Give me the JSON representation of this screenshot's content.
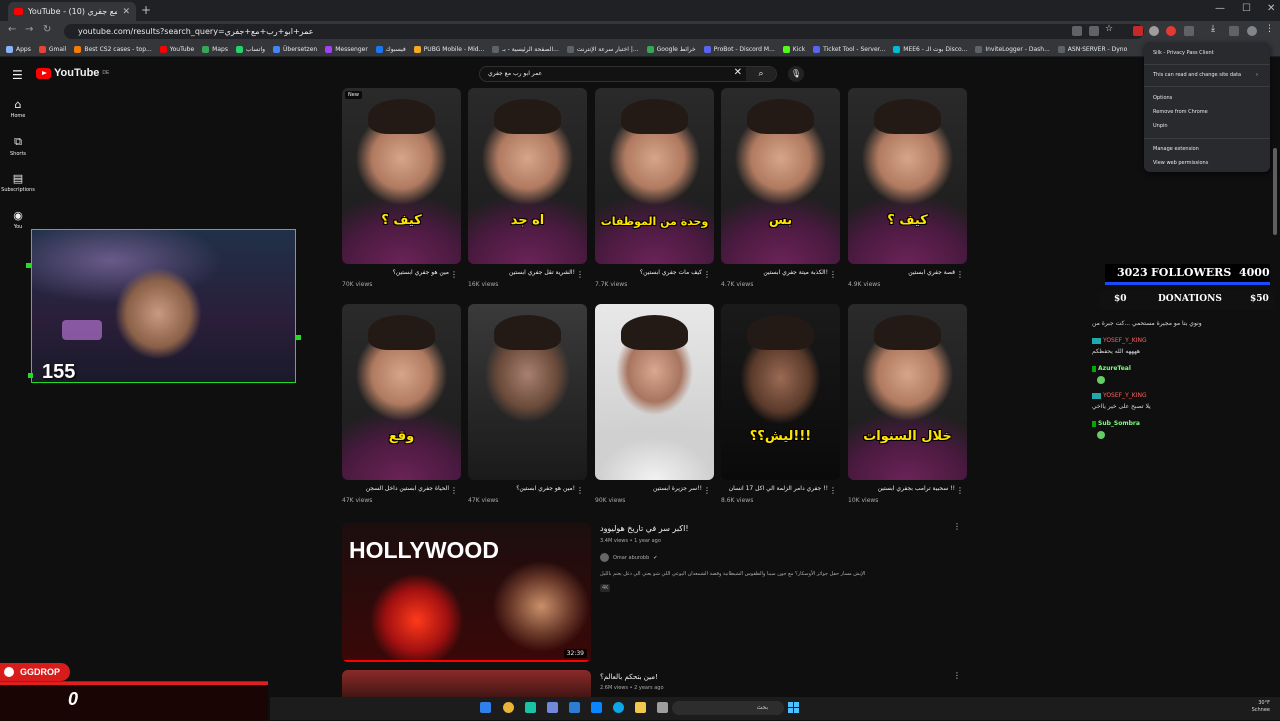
{
  "browser": {
    "tab_title": "YouTube - عمر ابو رب مع جفري (10)",
    "url": "youtube.com/results?search_query=عمر+ابو+رب+مع+جفري",
    "window_controls": [
      "—",
      "☐",
      "✕"
    ],
    "bookmarks": [
      "Apps",
      "Gmail",
      "Best CS2 cases - top...",
      "YouTube",
      "Maps",
      "واتساب",
      "Übersetzen",
      "Messenger",
      "فيسبوك",
      "PUBG Mobile - Mid...",
      "الصفحة الرئيسية - بـ...",
      "اختبار سرعة الإنترنت |...",
      "Google خرائط",
      "ProBot - Discord M...",
      "Kick",
      "Ticket Tool - Server...",
      "MEE6 - بوت الـ Disco...",
      "InviteLogger - Dash...",
      "ASN·SERVER - Dyno"
    ]
  },
  "extension_menu": {
    "header": "Silk - Privacy Pass Client",
    "site_data": "This can read and change site data",
    "options": "Options",
    "remove": "Remove from Chrome",
    "unpin": "Unpin",
    "manage": "Manage extension",
    "permissions": "View web permissions"
  },
  "youtube": {
    "logo": "YouTube",
    "region": "DE",
    "search_query": "عمر ابو رب مع جفري",
    "nav": [
      {
        "label": "Home",
        "icon": "home-icon"
      },
      {
        "label": "Shorts",
        "icon": "shorts-icon"
      },
      {
        "label": "Subscriptions",
        "icon": "subscriptions-icon"
      },
      {
        "label": "You",
        "icon": "you-icon"
      }
    ],
    "shorts_row1": [
      {
        "title": "مين هو جفري ابستين؟",
        "views": "70K views",
        "caption": "كيف ؟",
        "badge": "New"
      },
      {
        "title": "الشرية تقل جفري ابستين!",
        "views": "16K views",
        "caption": "اه جد",
        "badge": ""
      },
      {
        "title": "كيف مات جفري ابستين؟",
        "views": "7.7K views",
        "caption": "وحدة من الموظفات",
        "badge": ""
      },
      {
        "title": "الكذبة ميتة جفري ابستين!",
        "views": "4.7K views",
        "caption": "بس",
        "badge": ""
      },
      {
        "title": "قصة جفري ابستين",
        "views": "4.9K views",
        "caption": "كيف ؟",
        "badge": ""
      }
    ],
    "shorts_row2": [
      {
        "title": "الحياة جفري ابستين داخل السجن",
        "views": "47K views",
        "caption": "وقع"
      },
      {
        "title": "مين هو جفري ابستين؟!",
        "views": "47K views",
        "caption": ""
      },
      {
        "title": "سر جزيرة ابستين!!",
        "views": "90K views",
        "caption": ""
      },
      {
        "title": "جفري دامر الزلمة الي اكل 17 انسان !!",
        "views": "8.6K views",
        "caption": "ليش؟؟!!!"
      },
      {
        "title": "سحبية ترامب بجفري ابستين !!",
        "views": "10K views",
        "caption": "خلال السنوات"
      }
    ],
    "video1": {
      "title": "اكبر سر في تاريخ هوليوود!",
      "meta": "3.4M views • 1 year ago",
      "channel": "Omar aburobb",
      "description": "الإيش مسار حفل جوائز الأوسكار؟ مع جون سينا والطقوس الشيطانية وقصة الشمعدان اليوعي اللي شو يعني الي دغل يعتم بالليل",
      "badge": "4K",
      "thumb_text": "HOLLYWOOD",
      "duration": "32:39"
    },
    "video2": {
      "title": "مين بتحكم بالعالم؟!",
      "meta": "2.6M views • 2 years ago"
    }
  },
  "stream_overlay": {
    "webcam_count": "155",
    "followers_current": "3023",
    "followers_label": "FOLLOWERS",
    "followers_goal": "4000",
    "donations_current": "$0",
    "donations_label": "DONATIONS",
    "donations_goal": "$50",
    "chat": [
      {
        "user": "",
        "text": "ونوي بتا مو مجيرة مستحمي ...كت جبرة من"
      },
      {
        "user": "YOSEF_Y_KING",
        "text": ""
      },
      {
        "user": "",
        "text": "ههههه الله يحفظكم"
      },
      {
        "user": "AzureTeal",
        "text": ""
      },
      {
        "user": "YOSEF_Y_KING",
        "text": ""
      },
      {
        "user": "",
        "text": "يلا تصبح على خير يااخي"
      },
      {
        "user": "Sub_Sombra",
        "text": ""
      }
    ],
    "ggdrop_label": "GGDROP",
    "ggdrop_value": "0"
  },
  "taskbar": {
    "search_placeholder": "بحث",
    "weather_temp": "30°F",
    "weather_desc": "Schnee"
  }
}
